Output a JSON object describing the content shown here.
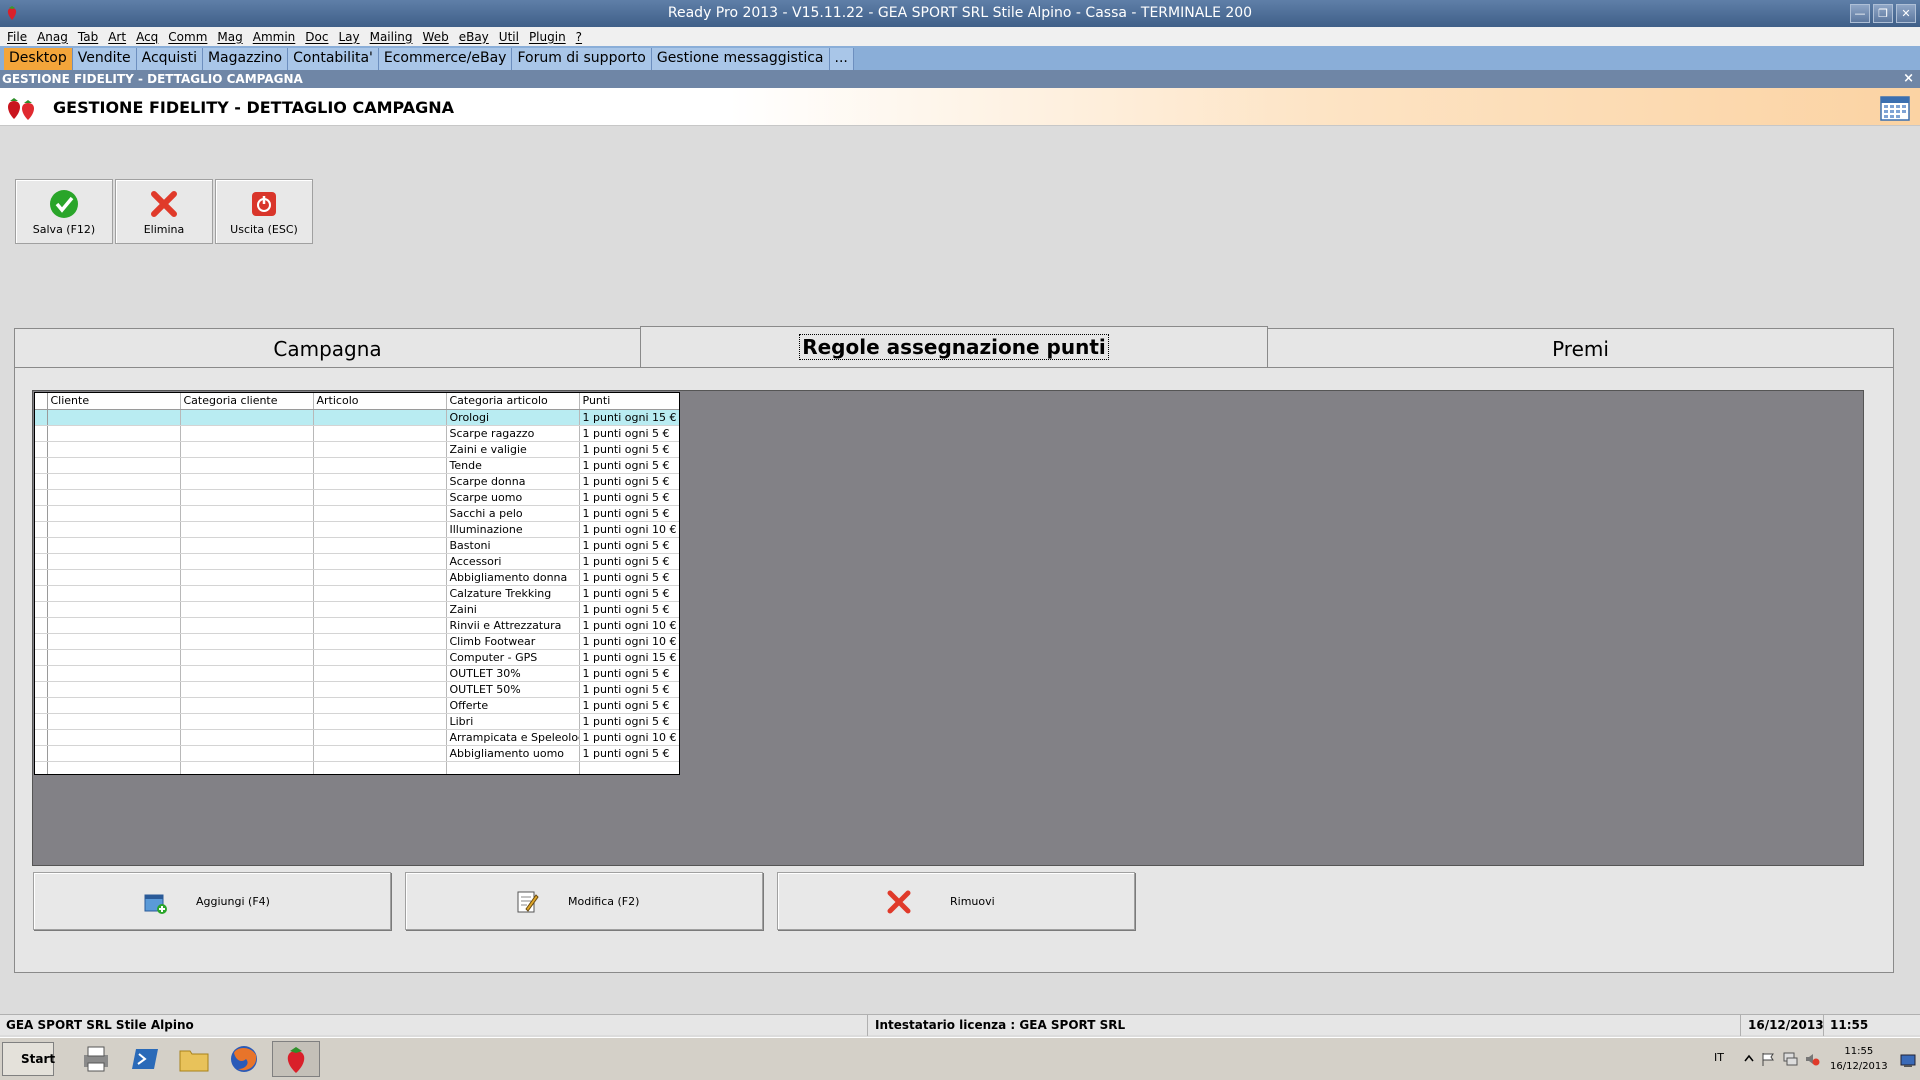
{
  "window": {
    "title": "Ready Pro 2013 - V15.11.22 - GEA SPORT SRL Stile Alpino - Cassa - TERMINALE 200"
  },
  "menu": [
    "File",
    "Anag",
    "Tab",
    "Art",
    "Acq",
    "Comm",
    "Mag",
    "Ammin",
    "Doc",
    "Lay",
    "Mailing",
    "Web",
    "eBay",
    "Util",
    "Plugin",
    "?"
  ],
  "nav_tabs": [
    "Desktop",
    "Vendite",
    "Acquisti",
    "Magazzino",
    "Contabilita'",
    "Ecommerce/eBay",
    "Forum di supporto",
    "Gestione messaggistica",
    "..."
  ],
  "subheader": {
    "title": "GESTIONE FIDELITY - DETTAGLIO CAMPAGNA",
    "close": "×"
  },
  "header": {
    "title": "GESTIONE FIDELITY - DETTAGLIO CAMPAGNA"
  },
  "toolbar": {
    "save": "Salva (F12)",
    "delete": "Elimina",
    "exit": "Uscita (ESC)"
  },
  "tabs": [
    "Campagna",
    "Regole assegnazione punti",
    "Premi"
  ],
  "grid": {
    "columns": [
      "Cliente",
      "Categoria cliente",
      "Articolo",
      "Categoria articolo",
      "Punti"
    ],
    "rows": [
      [
        "",
        "",
        "",
        "Orologi",
        "1 punti ogni 15 €"
      ],
      [
        "",
        "",
        "",
        "Scarpe ragazzo",
        "1 punti ogni 5 €"
      ],
      [
        "",
        "",
        "",
        "Zaini e valigie",
        "1 punti ogni 5 €"
      ],
      [
        "",
        "",
        "",
        "Tende",
        "1 punti ogni 5 €"
      ],
      [
        "",
        "",
        "",
        "Scarpe donna",
        "1 punti ogni 5 €"
      ],
      [
        "",
        "",
        "",
        "Scarpe uomo",
        "1 punti ogni 5 €"
      ],
      [
        "",
        "",
        "",
        "Sacchi a pelo",
        "1 punti ogni 5 €"
      ],
      [
        "",
        "",
        "",
        "Illuminazione",
        "1 punti ogni 10 €"
      ],
      [
        "",
        "",
        "",
        "Bastoni",
        "1 punti ogni 5 €"
      ],
      [
        "",
        "",
        "",
        "Accessori",
        "1 punti ogni 5 €"
      ],
      [
        "",
        "",
        "",
        "Abbigliamento donna",
        "1 punti ogni 5 €"
      ],
      [
        "",
        "",
        "",
        "Calzature Trekking",
        "1 punti ogni 5 €"
      ],
      [
        "",
        "",
        "",
        "Zaini",
        "1 punti ogni 5 €"
      ],
      [
        "",
        "",
        "",
        "Rinvii e Attrezzatura",
        "1 punti ogni 10 €"
      ],
      [
        "",
        "",
        "",
        "Climb Footwear",
        "1 punti ogni 10 €"
      ],
      [
        "",
        "",
        "",
        "Computer - GPS",
        "1 punti ogni 15 €"
      ],
      [
        "",
        "",
        "",
        "OUTLET 30%",
        "1 punti ogni 5 €"
      ],
      [
        "",
        "",
        "",
        "OUTLET 50%",
        "1 punti ogni 5 €"
      ],
      [
        "",
        "",
        "",
        "Offerte",
        "1 punti ogni 5 €"
      ],
      [
        "",
        "",
        "",
        "Libri",
        "1 punti ogni 5 €"
      ],
      [
        "",
        "",
        "",
        "Arrampicata e Speleologia",
        "1 punti ogni 10 €"
      ],
      [
        "",
        "",
        "",
        "Abbigliamento uomo",
        "1 punti ogni 5 €"
      ],
      [
        "",
        "",
        "",
        "",
        ""
      ]
    ]
  },
  "actions": {
    "add": "Aggiungi (F4)",
    "edit": "Modifica (F2)",
    "remove": "Rimuovi"
  },
  "status": {
    "company": "GEA SPORT SRL Stile Alpino",
    "license": "Intestatario licenza : GEA SPORT SRL",
    "date": "16/12/2013",
    "time": "11:55"
  },
  "taskbar": {
    "start": "Start",
    "lang": "IT",
    "clock_time": "11:55",
    "clock_date": "16/12/2013"
  },
  "colors": {
    "accent_tab": "#f3a53a",
    "nav_bg": "#8aaed8",
    "selected_row": "#b9ecf2",
    "grid_bg": "#828186"
  }
}
